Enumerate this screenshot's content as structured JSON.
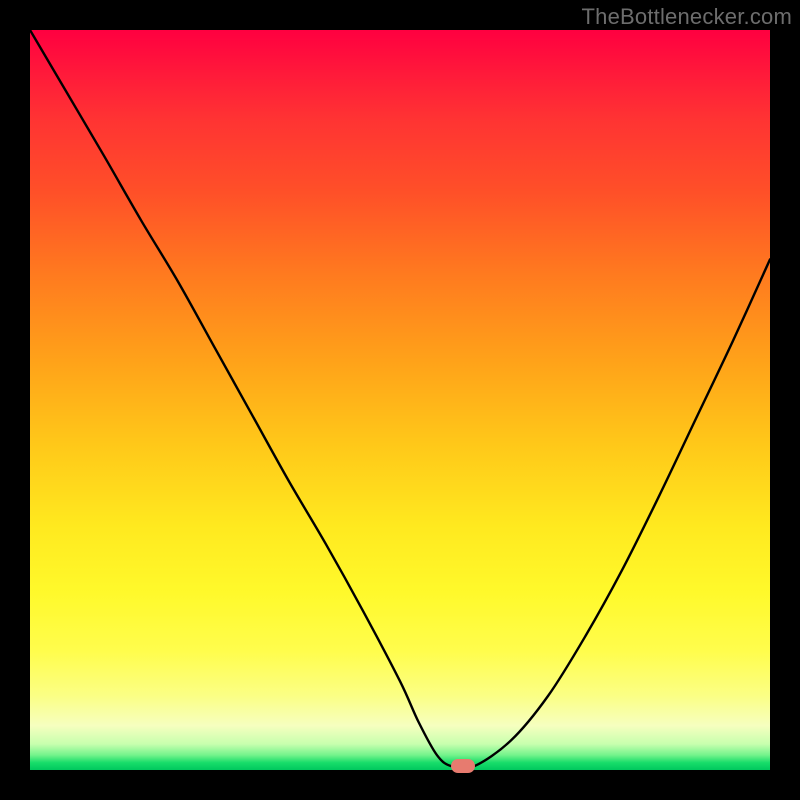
{
  "watermark": "TheBottlenecker.com",
  "chart_data": {
    "type": "line",
    "title": "",
    "xlabel": "",
    "ylabel": "",
    "xlim": [
      0,
      100
    ],
    "ylim": [
      0,
      100
    ],
    "x": [
      0,
      5,
      10,
      15,
      20,
      25,
      30,
      35,
      40,
      45,
      50,
      52.5,
      55,
      57,
      60,
      65,
      70,
      75,
      80,
      85,
      90,
      95,
      100
    ],
    "values": [
      100,
      91.5,
      83,
      74.3,
      66,
      57,
      48,
      39,
      30.5,
      21.5,
      12,
      6.5,
      2,
      0.5,
      0.5,
      4,
      10,
      18,
      27,
      37,
      47.5,
      58,
      69
    ],
    "marker": {
      "x": 58.5,
      "y": 0.5
    },
    "gradient_stops": [
      {
        "pos": 0.0,
        "color": "#ff0040"
      },
      {
        "pos": 0.5,
        "color": "#ffc819"
      },
      {
        "pos": 0.85,
        "color": "#fffd4d"
      },
      {
        "pos": 1.0,
        "color": "#00c85e"
      }
    ]
  }
}
